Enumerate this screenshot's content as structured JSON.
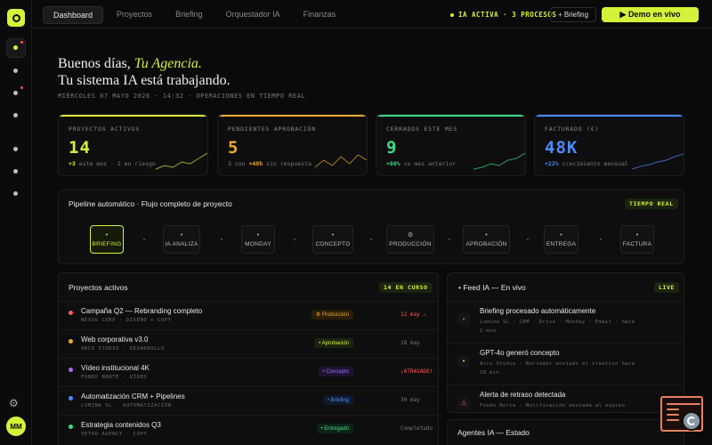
{
  "sidebar": {
    "avatar_initials": "MM"
  },
  "topbar": {
    "tabs": [
      "Dashboard",
      "Proyectos",
      "Briefing",
      "Orquestador IA",
      "Finanzas"
    ],
    "status": "IA ACTIVA · 3 PROCESOS",
    "briefing_button": "+ Briefing",
    "demo_button": "▶ Demo en vivo"
  },
  "greeting": {
    "line1_prefix": "Buenos días,",
    "agency": "Tu Agencia.",
    "line2": "Tu sistema IA está trabajando.",
    "dateline": "MIÉRCOLES 07 MAYO 2026 · 14:32 · OPERACIONES EN TIEMPO REAL"
  },
  "kpis": [
    {
      "label": "PROYECTOS ACTIVOS",
      "value": "14",
      "highlight": "+3",
      "sub": " este mes · 2 en riesgo",
      "color": "#d5f23a",
      "sparkline": [
        0.1,
        0.3,
        0.2,
        0.5,
        0.4,
        0.7,
        1.0
      ]
    },
    {
      "label": "PENDIENTES APROBACIÓN",
      "value": "5",
      "sub_prefix": "3 con ",
      "highlight": "+48h",
      "sub": " sin respuesta",
      "color": "#f0a830",
      "sparkline": [
        0.2,
        0.6,
        0.3,
        0.8,
        0.4,
        0.9,
        0.6
      ]
    },
    {
      "label": "CERRADOS ESTE MES",
      "value": "9",
      "highlight": "+80%",
      "sub": " vs mes anterior",
      "color": "#3ddc84",
      "sparkline": [
        0.1,
        0.2,
        0.4,
        0.3,
        0.6,
        0.7,
        1.0
      ]
    },
    {
      "label": "FACTURADO (€)",
      "value": "48K",
      "highlight": "+22%",
      "sub": " crecimiento mensual",
      "color": "#4a8cff",
      "sparkline": [
        0.1,
        0.25,
        0.35,
        0.5,
        0.6,
        0.8,
        0.95
      ]
    }
  ],
  "pipeline": {
    "title": "Pipeline automático · Flujo completo de proyecto",
    "badge": "TIEMPO REAL",
    "steps": [
      {
        "icon": "•",
        "label": "BRIEFING"
      },
      {
        "icon": "•",
        "label": "IA ANALIZA"
      },
      {
        "icon": "•",
        "label": "MONDAY"
      },
      {
        "icon": "•",
        "label": "CONCEPTO"
      },
      {
        "icon": "⚙",
        "label": "PRODUCCIÓN"
      },
      {
        "icon": "•",
        "label": "APROBACIÓN"
      },
      {
        "icon": "•",
        "label": "ENTREGA"
      },
      {
        "icon": "•",
        "label": "FACTURA"
      }
    ]
  },
  "projects": {
    "title": "Proyectos activos",
    "badge": "14 EN CURSO",
    "rows": [
      {
        "name": "Campaña Q2 — Rebranding completo",
        "meta": "NEXUS CORP · DISEÑO + COPY",
        "tag": "⚙ Producción",
        "date": "12 may ⚠",
        "dot": "#ff5a5a",
        "tag_color": "#f0a830",
        "tag_bg": "#2a1e08",
        "date_color": "#ff5a5a"
      },
      {
        "name": "Web corporativa v3.0",
        "meta": "ARCO STUDIO · DESARROLLO",
        "tag": "• Aprobación",
        "date": "18 may",
        "dot": "#f0a830",
        "tag_color": "#d5f23a",
        "tag_bg": "#1a2410",
        "date_color": "#777777"
      },
      {
        "name": "Vídeo institucional 4K",
        "meta": "FONDO NORTE · VÍDEO",
        "tag": "• Concepto",
        "date": "¡ATRASADO!",
        "dot": "#a56cff",
        "tag_color": "#a56cff",
        "tag_bg": "#1d1430",
        "date_color": "#ff5a5a"
      },
      {
        "name": "Automatización CRM + Pipelines",
        "meta": "LUMINA SL · AUTOMATIZACIÓN",
        "tag": "• Briefing",
        "date": "30 may",
        "dot": "#4a8cff",
        "tag_color": "#4a8cff",
        "tag_bg": "#0f1a2e",
        "date_color": "#777777"
      },
      {
        "name": "Estrategia contenidos Q3",
        "meta": "VETRO AGENCY · COPY",
        "tag": "• Entregado",
        "date": "Completado",
        "dot": "#3ddc84",
        "tag_color": "#3ddc84",
        "tag_bg": "#0c2418",
        "date_color": "#777777"
      }
    ]
  },
  "feed": {
    "title": "• Feed IA — En vivo",
    "badge": "LIVE",
    "items": [
      {
        "icon": "•",
        "icon_color": "#4a8cff",
        "title": "Briefing procesado automáticamente",
        "desc": "Lumina SL · CRM · Drive · Monday · Email · hace 2 min"
      },
      {
        "icon": "•",
        "icon_color": "#d5f23a",
        "title": "GPT-4o generó concepto",
        "desc": "Arco Studio · Borrador enviado al creativo hace 18 min"
      },
      {
        "icon": "⚠",
        "icon_color": "#ff5a5a",
        "title": "Alerta de retraso detectada",
        "desc": "Fondo Norte · Notificación enviada al equipo"
      }
    ]
  },
  "agents": {
    "title": "Agentes IA — Estado"
  }
}
